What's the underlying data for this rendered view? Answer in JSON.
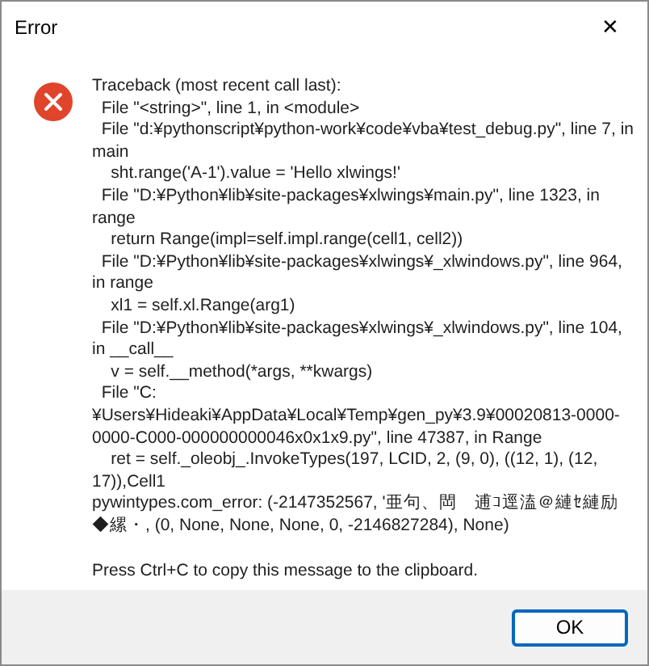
{
  "window": {
    "title": "Error",
    "close": "✕"
  },
  "message": {
    "text": "Traceback (most recent call last):\n  File \"<string>\", line 1, in <module>\n  File \"d:¥pythonscript¥python-work¥code¥vba¥test_debug.py\", line 7, in main\n    sht.range('A-1').value = 'Hello xlwings!'\n  File \"D:¥Python¥lib¥site-packages¥xlwings¥main.py\", line 1323, in range\n    return Range(impl=self.impl.range(cell1, cell2))\n  File \"D:¥Python¥lib¥site-packages¥xlwings¥_xlwindows.py\", line 964, in range\n    xl1 = self.xl.Range(arg1)\n  File \"D:¥Python¥lib¥site-packages¥xlwings¥_xlwindows.py\", line 104, in __call__\n    v = self.__method(*args, **kwargs)\n  File \"C:¥Users¥Hideaki¥AppData¥Local¥Temp¥gen_py¥3.9¥00020813-0000-0000-C000-000000000046x0x1x9.py\", line 47387, in Range\n    ret = self._oleobj_.InvokeTypes(197, LCID, 2, (9, 0), ((12, 1), (12, 17)),Cell1\npywintypes.com_error: (-2147352567, '亜句、閊　逋ｺ逕溘＠縺ｾ縺励◆縲・, (0, None, None, None, 0, -2146827284), None)",
    "hint": "Press Ctrl+C to copy this message to the clipboard."
  },
  "buttons": [
    {
      "label": "OK",
      "default": true
    }
  ]
}
